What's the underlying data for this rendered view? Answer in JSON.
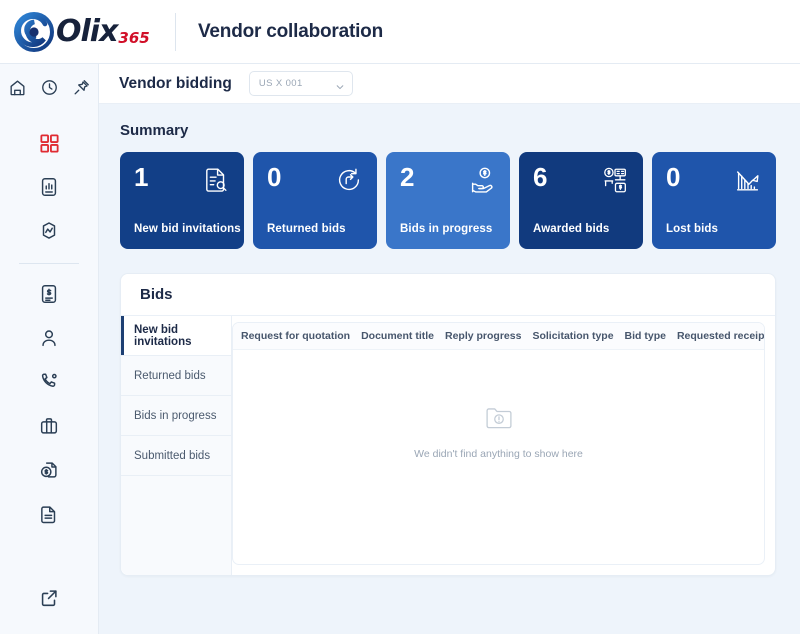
{
  "brand": {
    "logo_icon": "olix-swirl-icon",
    "name_primary": "Olix",
    "name_suffix": "365",
    "accent_red": "#d10f28",
    "accent_navy": "#17223b"
  },
  "header": {
    "app_title": "Vendor collaboration"
  },
  "rail": {
    "top_icons": [
      {
        "name": "home-icon",
        "label": "Home"
      },
      {
        "name": "clock-icon",
        "label": "Recent"
      },
      {
        "name": "pin-icon",
        "label": "Pinned"
      }
    ],
    "nav_icons": [
      {
        "name": "grid-icon",
        "label": "Modules",
        "color": "#e02b32",
        "active": true
      },
      {
        "name": "report-document-icon",
        "label": "Reports",
        "color": "#2b3f55"
      },
      {
        "name": "activity-icon",
        "label": "Activity",
        "color": "#2b3f55"
      }
    ],
    "nav_icons_secondary": [
      {
        "name": "invoice-icon",
        "label": "Invoices",
        "color": "#2b3f55"
      },
      {
        "name": "person-icon",
        "label": "Contacts",
        "color": "#2b3f55"
      },
      {
        "name": "phone-icon",
        "label": "Calls",
        "color": "#2b3f55"
      },
      {
        "name": "briefcase-icon",
        "label": "Procurement",
        "color": "#2b3f55"
      },
      {
        "name": "money-document-icon",
        "label": "Payments",
        "color": "#2b3f55"
      },
      {
        "name": "document-icon",
        "label": "Documents",
        "color": "#2b3f55"
      }
    ],
    "bottom_icon": {
      "name": "external-link-icon",
      "label": "Open in new window"
    }
  },
  "page": {
    "title": "Vendor bidding",
    "company_select": {
      "value": "US X 001",
      "icon": "chevron-down-icon"
    }
  },
  "summary": {
    "title": "Summary",
    "cards": [
      {
        "value": "1",
        "label": "New bid invitations",
        "color": "#123f87",
        "icon": "document-search-icon"
      },
      {
        "value": "0",
        "label": "Returned bids",
        "color": "#1f55ab",
        "icon": "return-arrow-icon"
      },
      {
        "value": "2",
        "label": "Bids in progress",
        "color": "#3a76c9",
        "icon": "hand-money-icon"
      },
      {
        "value": "6",
        "label": "Awarded bids",
        "color": "#113a7e",
        "icon": "award-contract-icon"
      },
      {
        "value": "0",
        "label": "Lost bids",
        "color": "#1f55ab",
        "icon": "declining-chart-icon"
      }
    ]
  },
  "bids_panel": {
    "title": "Bids",
    "tabs": [
      {
        "label": "New bid invitations",
        "active": true
      },
      {
        "label": "Returned bids",
        "active": false
      },
      {
        "label": "Bids in progress",
        "active": false
      },
      {
        "label": "Submitted bids",
        "active": false
      }
    ],
    "columns": [
      "Request for quotation",
      "Document title",
      "Reply progress",
      "Solicitation type",
      "Bid type",
      "Requested receipt date"
    ],
    "empty_state": {
      "icon": "folder-alert-icon",
      "message": "We didn't find anything to show here"
    },
    "rows": []
  }
}
